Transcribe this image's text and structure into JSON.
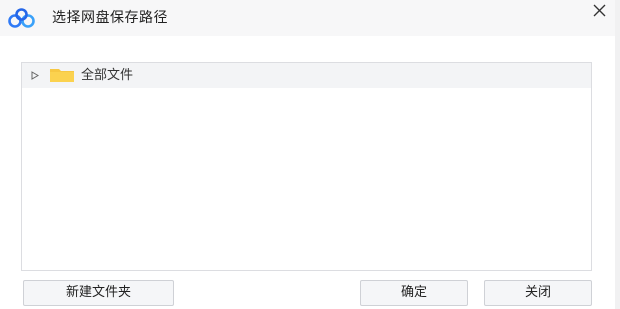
{
  "dialog": {
    "title": "选择网盘保存路径",
    "logo_icon": "baidu-netdisk-cloud-logo",
    "close_icon": "close-icon"
  },
  "tree": {
    "items": [
      {
        "label": "全部文件",
        "icon": "folder-icon",
        "expander_icon": "expand-arrow-icon",
        "expanded": false
      }
    ]
  },
  "buttons": {
    "new_folder_label": "新建文件夹",
    "confirm_label": "确定",
    "close_label": "关闭"
  },
  "colors": {
    "title_bar_bg": "#f7f7f8",
    "folder_yellow": "#f7c843",
    "logo_blue": "#2f7af6",
    "tree_row_bg": "#f3f4f6"
  }
}
